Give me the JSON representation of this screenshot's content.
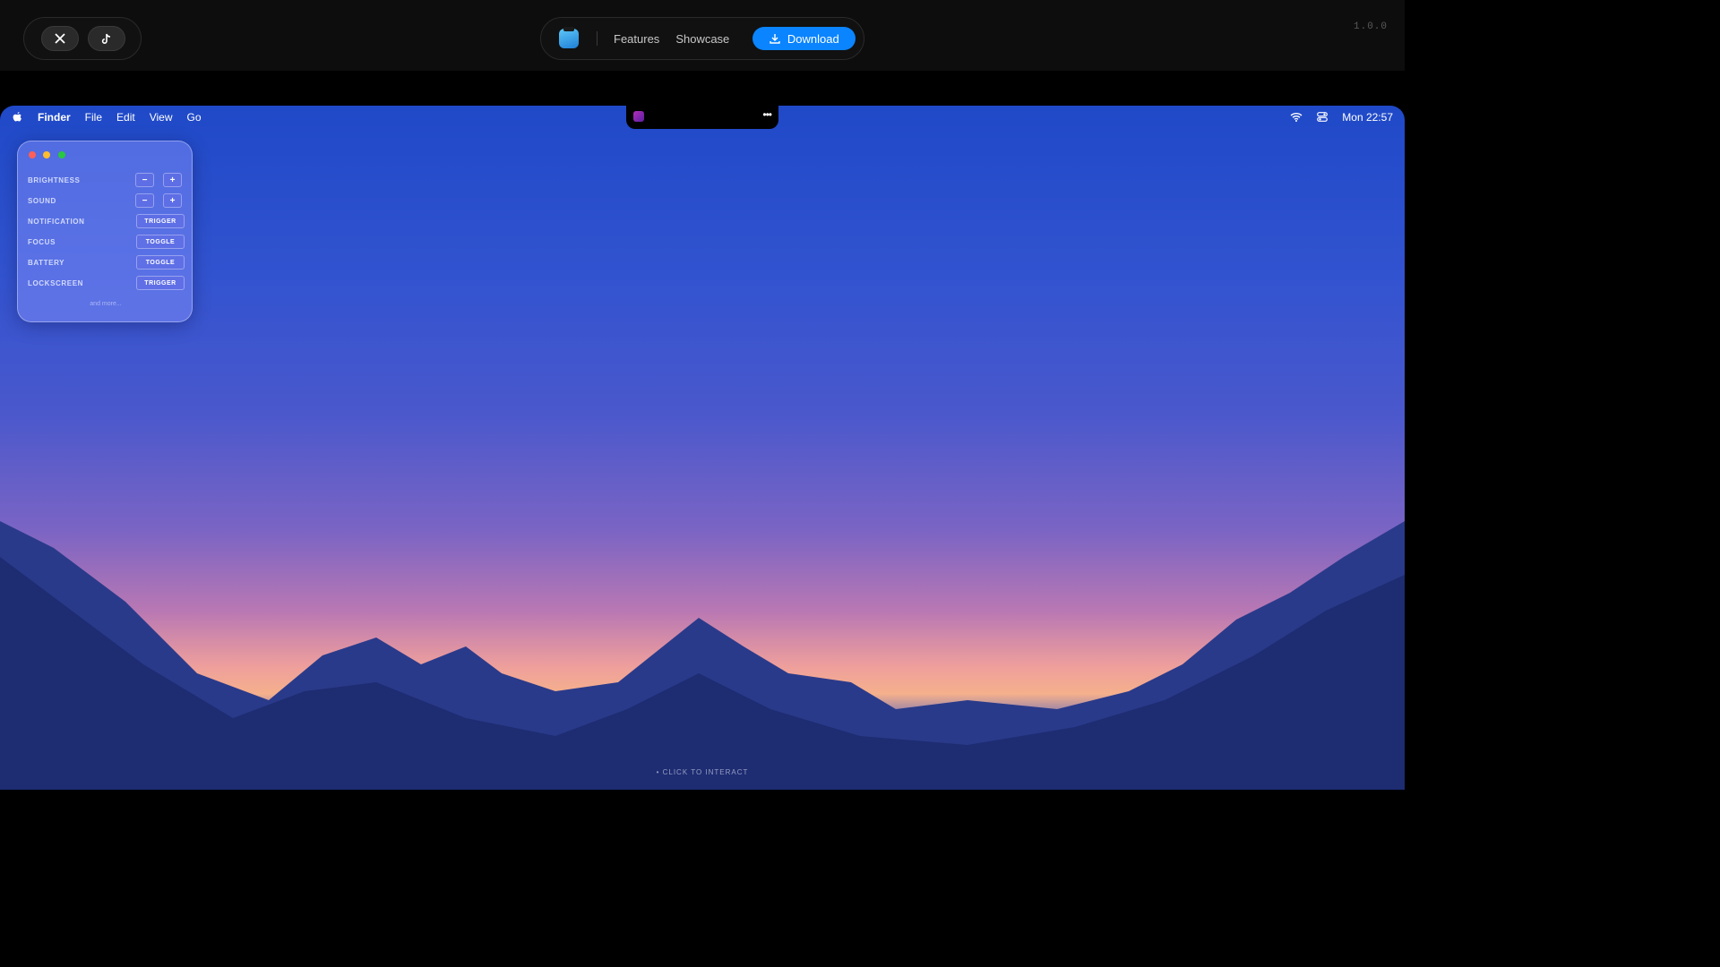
{
  "header": {
    "social": [
      {
        "icon": "x-logo-icon"
      },
      {
        "icon": "tiktok-icon"
      }
    ],
    "nav": {
      "features": "Features",
      "showcase": "Showcase",
      "download": "Download"
    },
    "version": "1.0.0"
  },
  "menubar": {
    "items": [
      "Finder",
      "File",
      "Edit",
      "View",
      "Go"
    ],
    "clock": "Mon 22:57"
  },
  "panel": {
    "rows": [
      {
        "label": "BRIGHTNESS",
        "minus": "−",
        "plus": "+"
      },
      {
        "label": "SOUND",
        "minus": "−",
        "plus": "+"
      },
      {
        "label": "NOTIFICATION",
        "action": "TRIGGER"
      },
      {
        "label": "FOCUS",
        "action": "TOGGLE"
      },
      {
        "label": "BATTERY",
        "action": "TOGGLE"
      },
      {
        "label": "LOCKSCREEN",
        "action": "TRIGGER"
      }
    ],
    "more": "and more..."
  },
  "notch": {
    "more": "•••"
  },
  "cta": "CLICK TO INTERACT",
  "colors": {
    "accent": "#0a84ff",
    "close": "#ff5f57",
    "minimize": "#febc2e",
    "zoom": "#28c840"
  }
}
